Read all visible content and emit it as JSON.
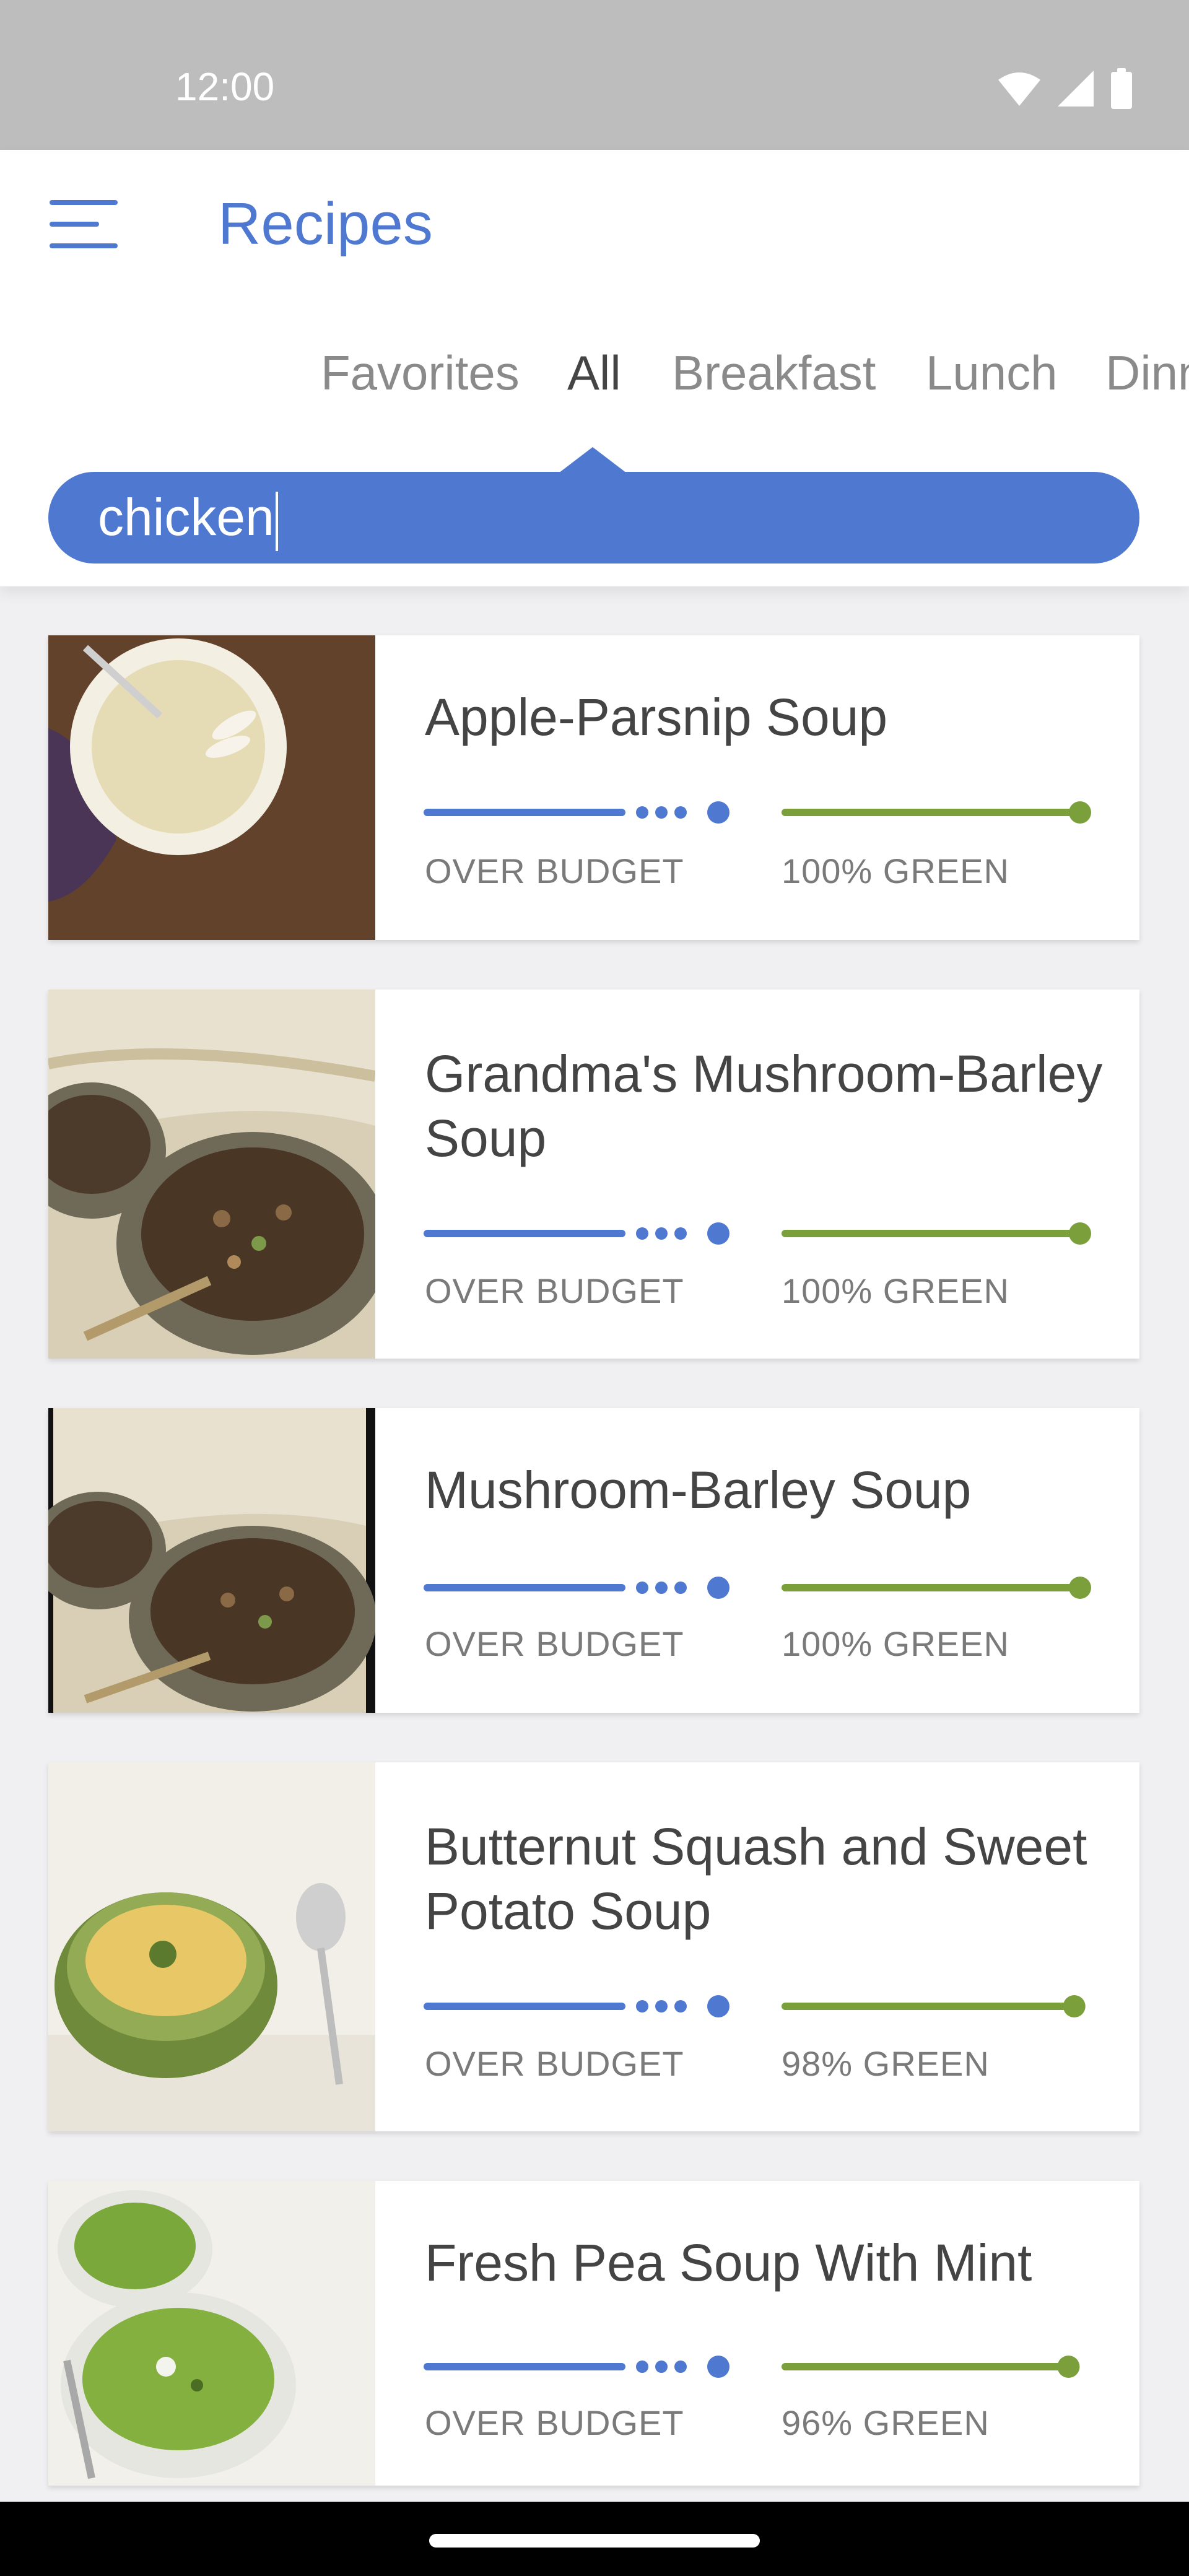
{
  "status_bar": {
    "time": "12:00"
  },
  "app_bar": {
    "title": "Recipes"
  },
  "tabs": [
    {
      "label": "Favorites",
      "active": false
    },
    {
      "label": "All",
      "active": true
    },
    {
      "label": "Breakfast",
      "active": false
    },
    {
      "label": "Lunch",
      "active": false
    },
    {
      "label": "Dinner",
      "active": false
    }
  ],
  "search": {
    "value": "chicken"
  },
  "colors": {
    "accent": "#4f79d1",
    "green": "#7a9f3b",
    "text": "#444444"
  },
  "recipes": [
    {
      "title": "Apple-Parsnip Soup",
      "budget_label": "OVER BUDGET",
      "green_label": "100% GREEN",
      "green_percent": 100,
      "image": "apple-parsnip-soup-photo"
    },
    {
      "title": "Grandma's Mushroom-Barley Soup",
      "budget_label": "OVER BUDGET",
      "green_label": "100% GREEN",
      "green_percent": 100,
      "image": "mushroom-barley-soup-photo"
    },
    {
      "title": "Mushroom-Barley Soup",
      "budget_label": "OVER BUDGET",
      "green_label": "100% GREEN",
      "green_percent": 100,
      "image": "mushroom-barley-soup-photo"
    },
    {
      "title": "Butternut Squash and Sweet Potato Soup",
      "budget_label": "OVER BUDGET",
      "green_label": "98% GREEN",
      "green_percent": 98,
      "image": "butternut-squash-soup-photo"
    },
    {
      "title": "Fresh Pea Soup With Mint",
      "budget_label": "OVER BUDGET",
      "green_label": "96% GREEN",
      "green_percent": 96,
      "image": "pea-soup-photo"
    }
  ]
}
